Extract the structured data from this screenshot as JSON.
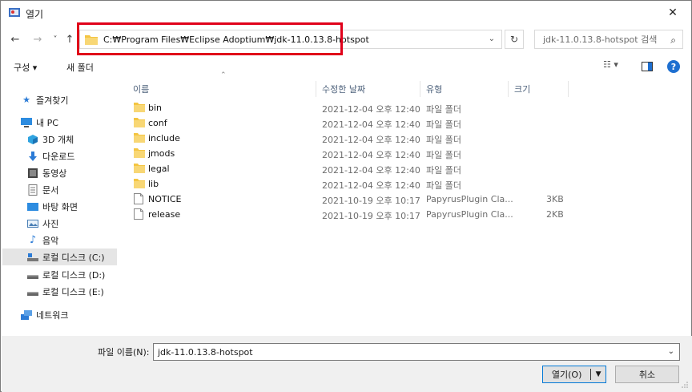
{
  "window": {
    "title": "열기",
    "close_label": "✕"
  },
  "nav_buttons": {
    "back": "←",
    "forward": "→",
    "recent": "˅",
    "up": "↑"
  },
  "address": {
    "path": "C:₩Program Files₩Eclipse Adoptium₩jdk-11.0.13.8-hotspot"
  },
  "search": {
    "placeholder": "jdk-11.0.13.8-hotspot 검색"
  },
  "toolbar": {
    "organize": "구성 ▾",
    "new_folder": "새 폴더",
    "help": "?"
  },
  "sidebar": {
    "items": [
      {
        "label": "즐겨찾기",
        "icon": "star-icon"
      },
      {
        "label": "내 PC",
        "icon": "pc-icon"
      },
      {
        "label": "3D 개체",
        "icon": "cube-icon"
      },
      {
        "label": "다운로드",
        "icon": "download-icon"
      },
      {
        "label": "동영상",
        "icon": "video-icon"
      },
      {
        "label": "문서",
        "icon": "document-icon"
      },
      {
        "label": "바탕 화면",
        "icon": "desktop-icon"
      },
      {
        "label": "사진",
        "icon": "picture-icon"
      },
      {
        "label": "음악",
        "icon": "music-icon"
      },
      {
        "label": "로컬 디스크 (C:)",
        "icon": "drive-c-icon"
      },
      {
        "label": "로컬 디스크 (D:)",
        "icon": "drive-icon"
      },
      {
        "label": "로컬 디스크 (E:)",
        "icon": "drive-icon"
      },
      {
        "label": "네트워크",
        "icon": "network-icon"
      }
    ]
  },
  "columns": {
    "name": "이름",
    "date": "수정한 날짜",
    "type": "유형",
    "size": "크기"
  },
  "files": [
    {
      "name": "bin",
      "date": "2021-12-04 오후 12:40",
      "type": "파일 폴더",
      "size": "",
      "kind": "folder"
    },
    {
      "name": "conf",
      "date": "2021-12-04 오후 12:40",
      "type": "파일 폴더",
      "size": "",
      "kind": "folder"
    },
    {
      "name": "include",
      "date": "2021-12-04 오후 12:40",
      "type": "파일 폴더",
      "size": "",
      "kind": "folder"
    },
    {
      "name": "jmods",
      "date": "2021-12-04 오후 12:40",
      "type": "파일 폴더",
      "size": "",
      "kind": "folder"
    },
    {
      "name": "legal",
      "date": "2021-12-04 오후 12:40",
      "type": "파일 폴더",
      "size": "",
      "kind": "folder"
    },
    {
      "name": "lib",
      "date": "2021-12-04 오후 12:40",
      "type": "파일 폴더",
      "size": "",
      "kind": "folder"
    },
    {
      "name": "NOTICE",
      "date": "2021-10-19 오후 10:17",
      "type": "PapyrusPlugin Cla...",
      "size": "3KB",
      "kind": "file"
    },
    {
      "name": "release",
      "date": "2021-10-19 오후 10:17",
      "type": "PapyrusPlugin Cla...",
      "size": "2KB",
      "kind": "file"
    }
  ],
  "footer": {
    "filename_label": "파일 이름(N):",
    "filename_value": "jdk-11.0.13.8-hotspot",
    "open_label": "열기(O)",
    "cancel_label": "취소"
  },
  "colors": {
    "highlight": "#e0001a",
    "folder": "#f4c542",
    "accent": "#0078d7"
  }
}
